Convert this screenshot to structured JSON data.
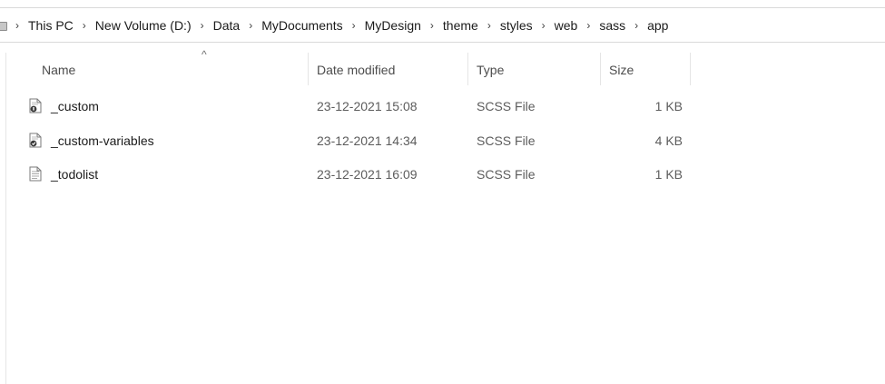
{
  "breadcrumb": [
    "This PC",
    "New Volume (D:)",
    "Data",
    "MyDocuments",
    "MyDesign",
    "theme",
    "styles",
    "web",
    "sass",
    "app"
  ],
  "columns": {
    "name": "Name",
    "date_modified": "Date modified",
    "type": "Type",
    "size": "Size"
  },
  "files": [
    {
      "name": "_custom",
      "date_modified": "23-12-2021 15:08",
      "type": "SCSS File",
      "size": "1 KB",
      "icon": "scss-file-icon"
    },
    {
      "name": "_custom-variables",
      "date_modified": "23-12-2021 14:34",
      "type": "SCSS File",
      "size": "4 KB",
      "icon": "scss-file-icon"
    },
    {
      "name": "_todolist",
      "date_modified": "23-12-2021 16:09",
      "type": "SCSS File",
      "size": "1 KB",
      "icon": "text-file-icon"
    }
  ],
  "sort_indicator": "^"
}
